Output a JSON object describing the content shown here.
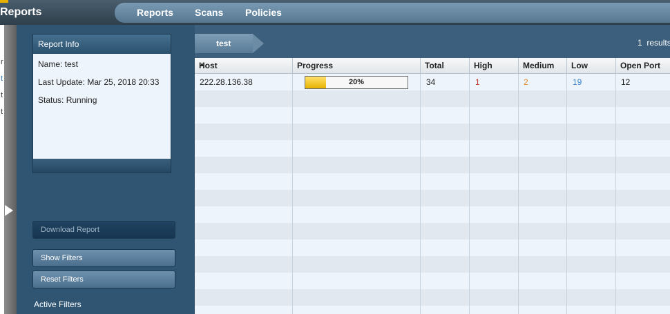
{
  "app": {
    "title": "Reports"
  },
  "nav": {
    "items": [
      "Reports",
      "Scans",
      "Policies"
    ]
  },
  "left_fragments": [
    "r",
    "t",
    "t",
    "t"
  ],
  "report_info": {
    "title": "Report Info",
    "name": "Name: test",
    "last_update": "Last Update: Mar 25, 2018 20:33",
    "status": "Status: Running"
  },
  "buttons": {
    "download": "Download Report",
    "show_filters": "Show Filters",
    "reset_filters": "Reset Filters"
  },
  "active_filters_label": "Active Filters",
  "breadcrumb": {
    "label": "test"
  },
  "results": {
    "count": "1",
    "label": "results"
  },
  "table": {
    "columns": [
      "Host",
      "Progress",
      "Total",
      "High",
      "Medium",
      "Low",
      "Open Port"
    ],
    "sorted_column": "Host",
    "sort_direction": "ascending",
    "rows": [
      {
        "host": "222.28.136.38",
        "progress_label": "20%",
        "progress_value": 0.2,
        "total": "34",
        "high": "1",
        "medium": "2",
        "low": "19",
        "open_port": "12"
      }
    ]
  },
  "colors": {
    "high": "#c0392b",
    "medium": "#e0892a",
    "low": "#3f86c6",
    "accent_yellow": "#e6b100"
  }
}
